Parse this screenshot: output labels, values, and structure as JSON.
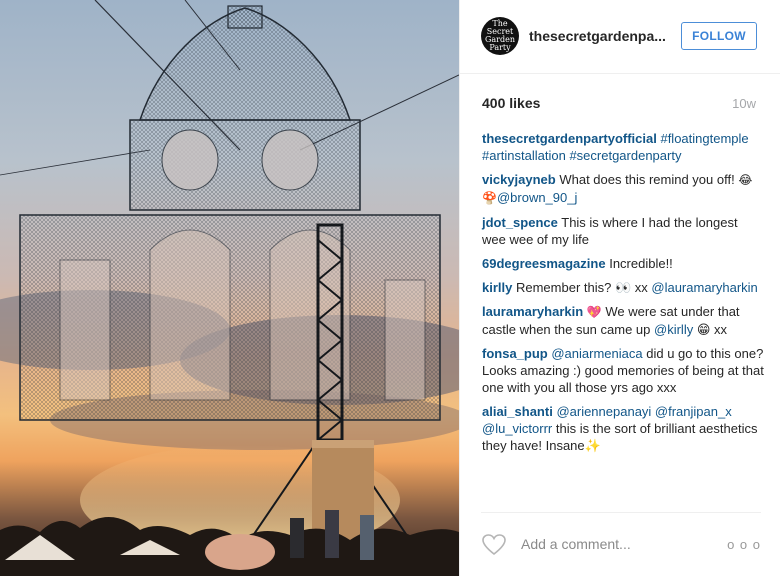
{
  "photo": {
    "alt": "Floating temple art installation at sunset"
  },
  "header": {
    "username": "thesecretgardenpa...",
    "avatar_text": "The Secret Garden Party",
    "follow_label": "FOLLOW"
  },
  "meta": {
    "likes": "400 likes",
    "time": "10w"
  },
  "caption": {
    "author": "thesecretgardenpartyofficial",
    "text": "#floatingtemple #artinstallation #secretgardenparty"
  },
  "comments": [
    {
      "author": "vickyjayneb",
      "text": "What does this remind you off!",
      "emoji": "😂🍄",
      "mention": "@brown_90_j"
    },
    {
      "author": "jdot_spence",
      "text": "This is where I had the longest wee wee of my life"
    },
    {
      "author": "69degreesmagazine",
      "text": "Incredible!!"
    },
    {
      "author": "kirlly",
      "text": "Remember this? 👀 xx",
      "mention": "@lauramaryharkin"
    },
    {
      "author": "lauramaryharkin",
      "emoji": "💖",
      "text": "We were sat under that castle when the sun came up",
      "mention": "@kirlly",
      "after": "😁 xx"
    },
    {
      "author": "fonsa_pup",
      "mention": "@aniarmeniaca",
      "text": "did u go to this one? Looks amazing :) good memories of being at that one with you all those yrs ago xxx"
    },
    {
      "author": "aliai_shanti",
      "mention": "@ariennepanayi @franjipan_x @lu_victorrr",
      "text": "this is the sort of brilliant aesthetics they have! Insane✨"
    }
  ],
  "footer": {
    "placeholder": "Add a comment...",
    "more": "o o o"
  }
}
